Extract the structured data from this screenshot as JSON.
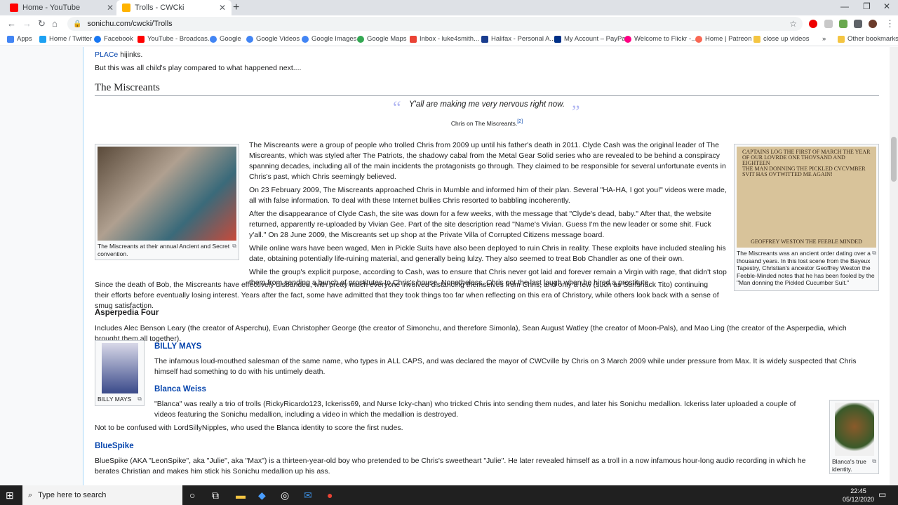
{
  "browser": {
    "tabs": [
      {
        "title": "Home - YouTube",
        "color": "#ff0000"
      },
      {
        "title": "Trolls - CWCki",
        "color": "#ffb300"
      }
    ],
    "new_tab": "+",
    "url": "sonichu.com/cwcki/Trolls",
    "bookmarks": [
      {
        "label": "Apps"
      },
      {
        "label": "Home / Twitter"
      },
      {
        "label": "Facebook"
      },
      {
        "label": "YouTube - Broadcas..."
      },
      {
        "label": "Google"
      },
      {
        "label": "Google Videos"
      },
      {
        "label": "Google Images"
      },
      {
        "label": "Google Maps"
      },
      {
        "label": "Inbox - luke4smith..."
      },
      {
        "label": "Halifax - Personal A..."
      },
      {
        "label": "My Account – PayPal"
      },
      {
        "label": "Welcome to Flickr -..."
      },
      {
        "label": "Home | Patreon"
      },
      {
        "label": "close up videos"
      },
      {
        "label": "»"
      },
      {
        "label": "Other bookmarks"
      }
    ]
  },
  "article": {
    "intro_line1_link": "PLACe",
    "intro_line1_rest": " hijinks.",
    "intro_line2": "But this was all child's play compared to what happened next....",
    "section_title": "The Miscreants",
    "quote": {
      "text": "Y'all are making me very nervous right now.",
      "attribution": "Chris on The Miscreants.",
      "ref": "[2]"
    },
    "thumb_left_caption": "The Miscreants at their annual Ancient and Secret convention.",
    "thumb_right_caption": "The Miscreants was an ancient order dating over a thousand years. In this lost scene from the Bayeux Tapestry, Christian's ancestor Geoffrey Weston the Feeble-Minded notes that he has been fooled by the \"Man donning the Pickled Cucumber Suit.\"",
    "tapestry_text": "CAPTAINS LOG THE FIRST OF MARCH THE YEAR OF OUR LOVRDE ONE THOVSAND AND EIGHTEEN\nTHE MAN DONNING THE PICKLED CVCVMBER SVIT HAS OVTWITTED ME AGAIN!",
    "tapestry_footer": "GEOFFREY WESTON THE FEEBLE MINDED",
    "paragraphs": [
      "The Miscreants were a group of people who trolled Chris from 2009 up until his father's death in 2011. Clyde Cash was the original leader of The Miscreants, which was styled after The Patriots, the shadowy cabal from the Metal Gear Solid series who are revealed to be behind a conspiracy spanning decades, including all of the main incidents the protagonists go through. They claimed to be responsible for several unfortunate events in Chris's past, which Chris seemingly believed.",
      "On 23 February 2009, The Miscreants approached Chris in Mumble and informed him of their plan. Several \"HA-HA, I got you!\" videos were made, all with false information. To deal with these Internet bullies Chris resorted to babbling incoherently.",
      "After the disappearance of Clyde Cash, the site was down for a few weeks, with the message that \"Clyde's dead, baby.\" After that, the website returned, apparently re-uploaded by Vivian Gee. Part of the site description read \"Name's Vivian. Guess I'm the new leader or some shit. Fuck y'all.\" On 28 June 2009, the Miscreants set up shop at the Private Villa of Corrupted Citizens message board.",
      "While online wars have been waged, Men in Pickle Suits have also been deployed to ruin Chris in reality. These exploits have included stealing his date, obtaining potentially life-ruining material, and generally being lulzy. They also seemed to treat Bob Chandler as one of their own.",
      "While the group's explicit purpose, according to Cash, was to ensure that Chris never got laid and forever remain a Virgin with rage, that didn't stop them from sending a bunch of prostitutes to Chris's house. Nonetheless, Chris got the last laugh when he hired a prostitute."
    ],
    "since_paragraph": "Since the death of Bob, the Miscreants have effectively disbanded, with pretty much everyone involved distancing themselves from Chris, and only a few (such as Surfshack Tito) continuing their efforts before eventually losing interest. Years after the fact, some have admitted that they took things too far when reflecting on this era of Christory, while others look back with a sense of smug satisfaction.",
    "asperpedia_title": "Asperpedia Four",
    "asperpedia_text": "Includes Alec Benson Leary (the creator of Asperchu), Evan Christopher George (the creator of Simonchu, and therefore Simonla), Sean August Watley (the creator of Moon-Pals), and Mao Ling (the creator of the Asperpedia, which brought them all together).",
    "billy": {
      "name": "BILLY MAYS",
      "caption": "BILLY MAYS",
      "text": "The infamous loud-mouthed salesman of the same name, who types in ALL CAPS, and was declared the mayor of CWCville by Chris on 3 March 2009 while under pressure from Max. It is widely suspected that Chris himself had something to do with his untimely death."
    },
    "blanca": {
      "name": "Blanca Weiss",
      "text": "\"Blanca\" was really a trio of trolls (RickyRicardo123, Ickeriss69, and Nurse Icky-chan) who tricked Chris into sending them nudes, and later his Sonichu medallion. Ickeriss later uploaded a couple of videos featuring the Sonichu medallion, including a video in which the medallion is destroyed.",
      "note": "Not to be confused with LordSillyNipples, who used the Blanca identity to score the first nudes.",
      "caption": "Blanca's true identity."
    },
    "bluespike": {
      "name": "BlueSpike",
      "text": "BlueSpike (AKA \"LeonSpike\", aka \"Julie\", aka \"Max\") is a thirteen-year-old boy who pretended to be Chris's sweetheart \"Julie\". He later revealed himself as a troll in a now infamous hour-long audio recording in which he berates Christian and makes him stick his Sonichu medallion up his ass."
    }
  },
  "taskbar": {
    "search_placeholder": "Type here to search",
    "time": "22:45",
    "date": "05/12/2020"
  }
}
